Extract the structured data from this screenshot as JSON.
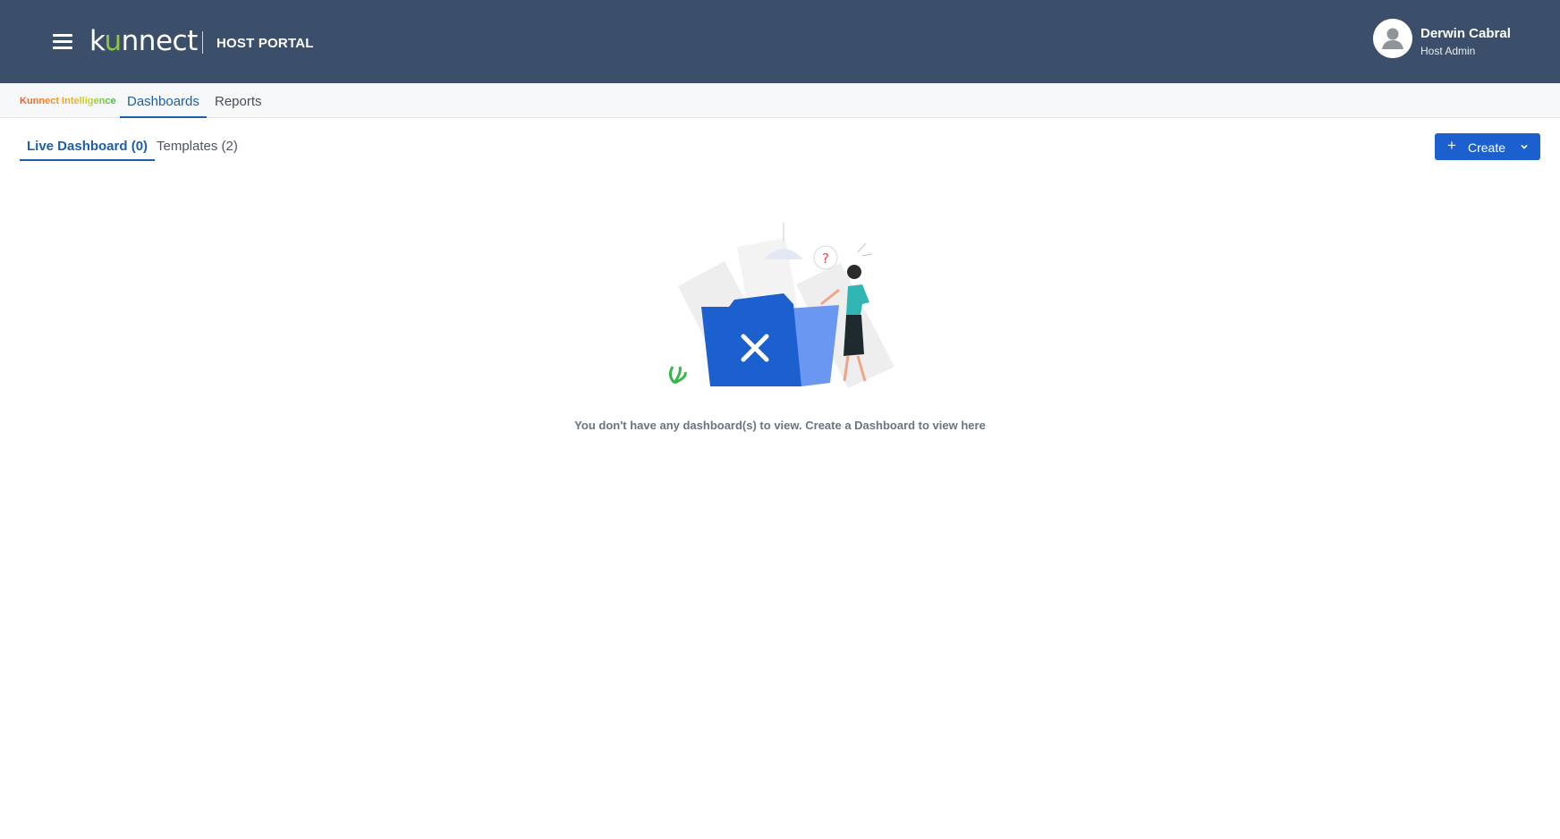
{
  "header": {
    "logo_text_prefix": "k",
    "logo_text_accent": "u",
    "logo_text_suffix": "nnect",
    "portal_label": "HOST PORTAL",
    "user_name": "Derwin Cabral",
    "user_role": "Host Admin",
    "menu_icon": "hamburger-menu-icon",
    "avatar_icon": "user-avatar-icon"
  },
  "subnav": {
    "brand": "Kunnect Intelligence",
    "tabs": [
      {
        "label": "Dashboards",
        "active": true
      },
      {
        "label": "Reports",
        "active": false
      }
    ]
  },
  "dashboard_tabs": [
    {
      "label": "Live Dashboard (0)",
      "active": true
    },
    {
      "label": "Templates (2)",
      "active": false
    }
  ],
  "create_button": {
    "label": "Create",
    "icon": "plus-icon",
    "dropdown_icon": "chevron-down-icon"
  },
  "empty_state": {
    "message": "You don't have any dashboard(s) to view. Create a Dashboard to view here",
    "illustration_icon": "empty-folder-illustration",
    "question_mark": "?"
  },
  "colors": {
    "header_bg": "#3b4f6b",
    "accent": "#1f5fa8",
    "button_bg": "#1c5fce",
    "logo_accent": "#8dc63f"
  }
}
